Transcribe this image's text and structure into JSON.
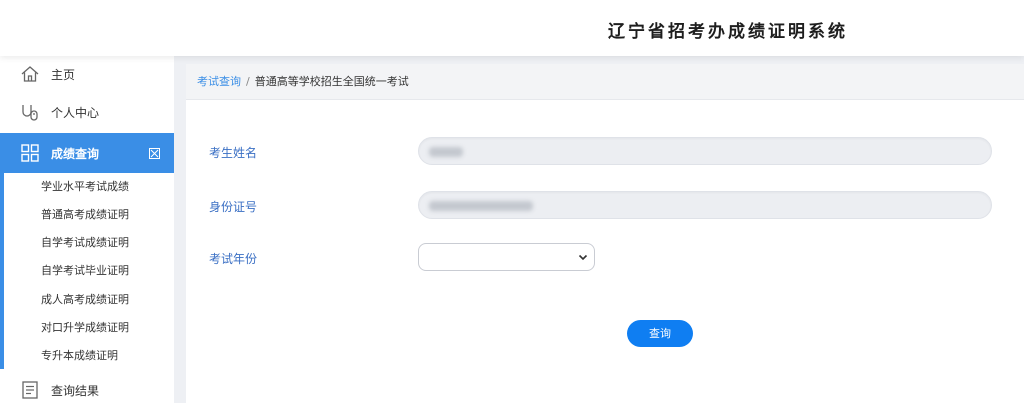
{
  "header": {
    "title": "辽宁省招考办成绩证明系统"
  },
  "sidebar": {
    "items": [
      {
        "label": "主页",
        "icon": "home-icon"
      },
      {
        "label": "个人中心",
        "icon": "user-icon"
      },
      {
        "label": "成绩查询",
        "icon": "grid-icon",
        "active": true
      },
      {
        "label": "查询结果",
        "icon": "document-icon"
      }
    ],
    "submenu": [
      {
        "label": "学业水平考试成绩"
      },
      {
        "label": "普通高考成绩证明"
      },
      {
        "label": "自学考试成绩证明"
      },
      {
        "label": "自学考试毕业证明"
      },
      {
        "label": "成人高考成绩证明"
      },
      {
        "label": "对口升学成绩证明"
      },
      {
        "label": "专升本成绩证明"
      }
    ]
  },
  "breadcrumb": {
    "root": "考试查询",
    "separator": "/",
    "current": "普通高等学校招生全国统一考试"
  },
  "form": {
    "name_label": "考生姓名",
    "id_label": "身份证号",
    "year_label": "考试年份",
    "submit_label": "查询"
  },
  "colors": {
    "accent": "#3a8ee6",
    "button": "#0f7ef2",
    "label": "#3a6fc4"
  }
}
